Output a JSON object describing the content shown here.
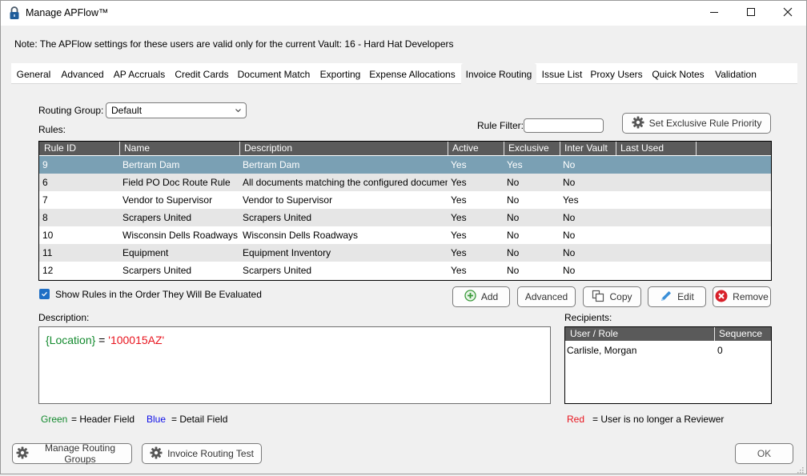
{
  "window": {
    "title": "Manage APFlow™",
    "icon": "padlock-icon",
    "controls": [
      "minimize-icon",
      "maximize-icon",
      "close-icon"
    ]
  },
  "note": "Note:  The APFlow settings for these users are valid only for the current Vault: 16 - Hard Hat Developers",
  "tabs": [
    {
      "label": "General"
    },
    {
      "label": "Advanced"
    },
    {
      "label": "AP Accruals"
    },
    {
      "label": "Credit Cards"
    },
    {
      "label": "Document Match"
    },
    {
      "label": "Exporting"
    },
    {
      "label": "Expense Allocations"
    },
    {
      "label": "Invoice Routing",
      "active": true
    },
    {
      "label": "Issue List"
    },
    {
      "label": "Proxy Users"
    },
    {
      "label": "Quick Notes"
    },
    {
      "label": "Validation"
    }
  ],
  "routing": {
    "group_label": "Routing Group:",
    "group_value": "Default",
    "rules_label": "Rules:",
    "filter_label": "Rule Filter:",
    "filter_value": "",
    "set_priority_label": "Set Exclusive Rule Priority"
  },
  "rules_table": {
    "columns": [
      "Rule ID",
      "Name",
      "Description",
      "Active",
      "Exclusive",
      "Inter Vault",
      "Last Used",
      ""
    ],
    "rows": [
      {
        "id": "9",
        "name": "Bertram Dam",
        "description": "Bertram Dam",
        "active": "Yes",
        "exclusive": "Yes",
        "inter_vault": "No",
        "last_used": "",
        "selected": true
      },
      {
        "id": "6",
        "name": "Field PO Doc Route Rule",
        "description": "All documents matching the configured document ty...",
        "active": "Yes",
        "exclusive": "No",
        "inter_vault": "No",
        "last_used": ""
      },
      {
        "id": "7",
        "name": "Vendor to Supervisor",
        "description": "Vendor to Supervisor",
        "active": "Yes",
        "exclusive": "No",
        "inter_vault": "Yes",
        "last_used": ""
      },
      {
        "id": "8",
        "name": "Scrapers United",
        "description": "Scrapers United",
        "active": "Yes",
        "exclusive": "No",
        "inter_vault": "No",
        "last_used": ""
      },
      {
        "id": "10",
        "name": "Wisconsin Dells Roadways",
        "description": "Wisconsin Dells Roadways",
        "active": "Yes",
        "exclusive": "No",
        "inter_vault": "No",
        "last_used": ""
      },
      {
        "id": "11",
        "name": "Equipment",
        "description": "Equipment Inventory",
        "active": "Yes",
        "exclusive": "No",
        "inter_vault": "No",
        "last_used": ""
      },
      {
        "id": "12",
        "name": "Scarpers United",
        "description": "Scarpers United",
        "active": "Yes",
        "exclusive": "No",
        "inter_vault": "No",
        "last_used": ""
      }
    ]
  },
  "show_order": {
    "label": "Show Rules in the Order They Will Be Evaluated",
    "checked": true
  },
  "rule_buttons": {
    "add": "Add",
    "advanced": "Advanced",
    "copy": "Copy",
    "edit": "Edit",
    "remove": "Remove"
  },
  "description": {
    "label": "Description:",
    "field": "{Location}",
    "operator": " = ",
    "value": "'100015AZ'"
  },
  "recipients": {
    "label": "Recipients:",
    "columns": [
      "User / Role",
      "Sequence"
    ],
    "rows": [
      {
        "user": "Carlisle, Morgan",
        "sequence": "0"
      }
    ]
  },
  "legend": {
    "green_word": "Green",
    "green_desc": "=  Header Field",
    "blue_word": "Blue",
    "blue_desc": "=  Detail Field",
    "red_word": "Red",
    "red_desc": "=  User is no longer a Reviewer"
  },
  "footer": {
    "manage_groups": "Manage Routing Groups",
    "routing_test": "Invoice Routing Test",
    "ok": "OK"
  },
  "colors": {
    "selected_row": "#7aa0b4",
    "header_bg": "#5a5a5a",
    "header_field": "#138a2e",
    "detail_field": "#1010e8",
    "not_reviewer": "#e8141e"
  }
}
